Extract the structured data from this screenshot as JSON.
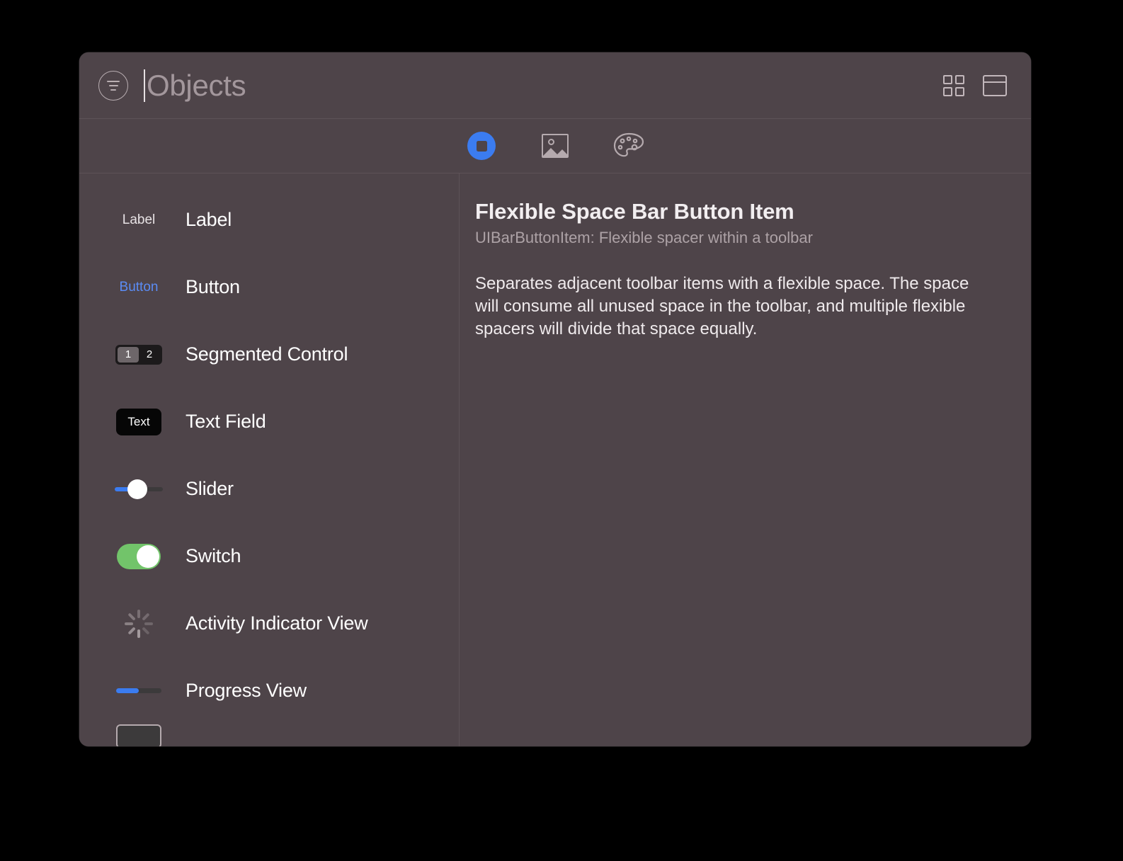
{
  "window": {
    "titlebar": {
      "filter_icon": "filter-sort-icon",
      "search_value": "",
      "search_placeholder": "Objects",
      "grid_view_icon": "grid-view-icon",
      "detail_view_icon": "panel-view-icon"
    },
    "tabs": [
      {
        "name": "objects",
        "icon": "objects-icon",
        "selected": true
      },
      {
        "name": "media",
        "icon": "media-image-icon",
        "selected": false
      },
      {
        "name": "colors",
        "icon": "color-palette-icon",
        "selected": false
      }
    ]
  },
  "library": {
    "items": [
      {
        "label": "Label",
        "icon": "label-preview-icon",
        "icon_text": "Label"
      },
      {
        "label": "Button",
        "icon": "button-preview-icon",
        "icon_text": "Button"
      },
      {
        "label": "Segmented Control",
        "icon": "segmented-control-preview-icon",
        "seg_one": "1",
        "seg_two": "2"
      },
      {
        "label": "Text Field",
        "icon": "text-field-preview-icon",
        "icon_text": "Text"
      },
      {
        "label": "Slider",
        "icon": "slider-preview-icon"
      },
      {
        "label": "Switch",
        "icon": "switch-preview-icon"
      },
      {
        "label": "Activity Indicator View",
        "icon": "activity-indicator-preview-icon"
      },
      {
        "label": "Progress View",
        "icon": "progress-view-preview-icon"
      }
    ]
  },
  "detail": {
    "title": "Flexible Space Bar Button Item",
    "subtitle": "UIBarButtonItem: Flexible spacer within a toolbar",
    "body": "Separates adjacent toolbar items with a flexible space. The space will consume all unused space in the toolbar, and multiple flexible spacers will divide that space equally."
  },
  "colors": {
    "window_background": "#4e4449",
    "accent_blue": "#3b7cf0",
    "switch_green": "#72c46a",
    "text_primary": "#ffffff",
    "text_secondary": "#ada2a6",
    "divider": "#5d5257"
  }
}
